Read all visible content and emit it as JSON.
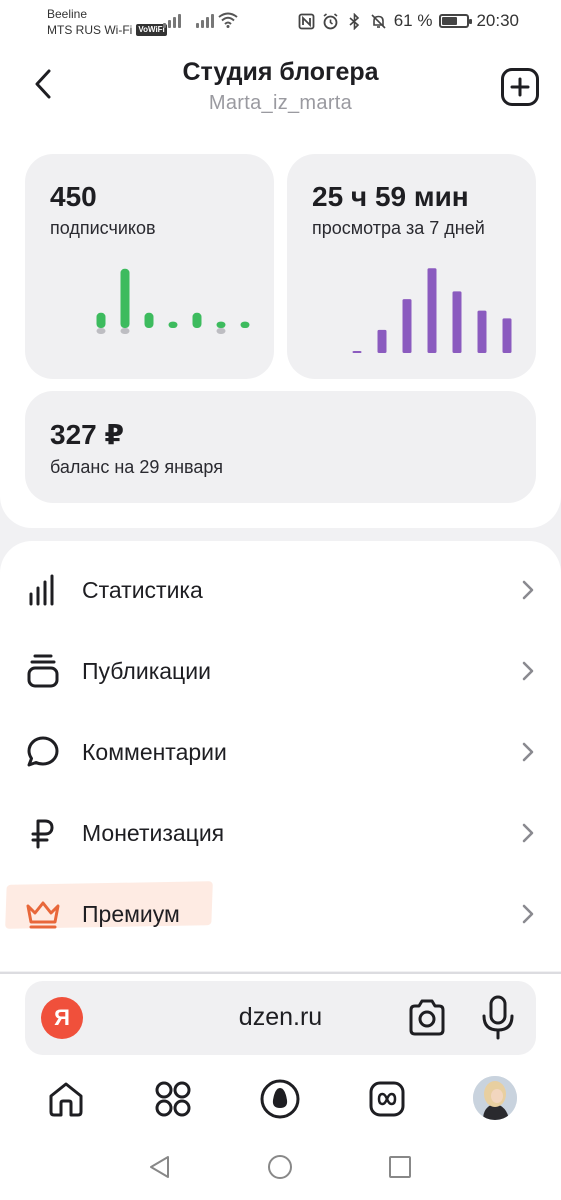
{
  "status_bar": {
    "carrier1": "Beeline",
    "carrier2": "MTS RUS Wi-Fi",
    "vowifi": "VoWiFi",
    "battery_percent": "61 %",
    "battery_level": 0.61,
    "time": "20:30",
    "icons": [
      "nfc-icon",
      "alarm-icon",
      "bluetooth-icon",
      "mute-icon"
    ]
  },
  "header": {
    "title": "Студия блогера",
    "subtitle": "Marta_iz_marta",
    "back_icon": "chevron-left-icon",
    "add_icon": "plus-square-icon"
  },
  "stats": {
    "subscribers": {
      "value": "450",
      "label": "подписчиков",
      "chart_color": "#3dbb5e"
    },
    "views": {
      "value": "25 ч 59 мин",
      "label": "просмотра за 7 дней",
      "chart_color": "#8b5bbf"
    },
    "balance": {
      "value": "327 ₽",
      "label": "баланс на 29 января"
    }
  },
  "chart_data": [
    {
      "type": "bar",
      "categories": [
        "1",
        "2",
        "3",
        "4",
        "5",
        "6",
        "7"
      ],
      "values": [
        3,
        13,
        3,
        1,
        3,
        1,
        1
      ],
      "negative_values": [
        1,
        1,
        0,
        0,
        0,
        1,
        0
      ]
    },
    {
      "type": "bar",
      "categories": [
        "1",
        "2",
        "3",
        "4",
        "5",
        "6",
        "7"
      ],
      "values": [
        0.5,
        6,
        14,
        22,
        16,
        11,
        9
      ]
    }
  ],
  "menu": {
    "items": [
      {
        "label": "Статистика",
        "icon": "bar-chart-icon"
      },
      {
        "label": "Публикации",
        "icon": "publications-stack-icon"
      },
      {
        "label": "Комментарии",
        "icon": "comment-bubble-icon"
      },
      {
        "label": "Монетизация",
        "icon": "ruble-icon"
      },
      {
        "label": "Премиум",
        "icon": "crown-icon"
      }
    ],
    "accent": "#e8673a"
  },
  "browser": {
    "logo": "Я",
    "url": "dzen.ru",
    "logo_color": "#f0503b"
  },
  "bottom_nav": [
    "home-icon",
    "apps-grid-icon",
    "alice-icon",
    "clips-icon",
    "profile-avatar"
  ],
  "system_nav": [
    "back-triangle-icon",
    "home-circle-icon",
    "recents-square-icon"
  ]
}
